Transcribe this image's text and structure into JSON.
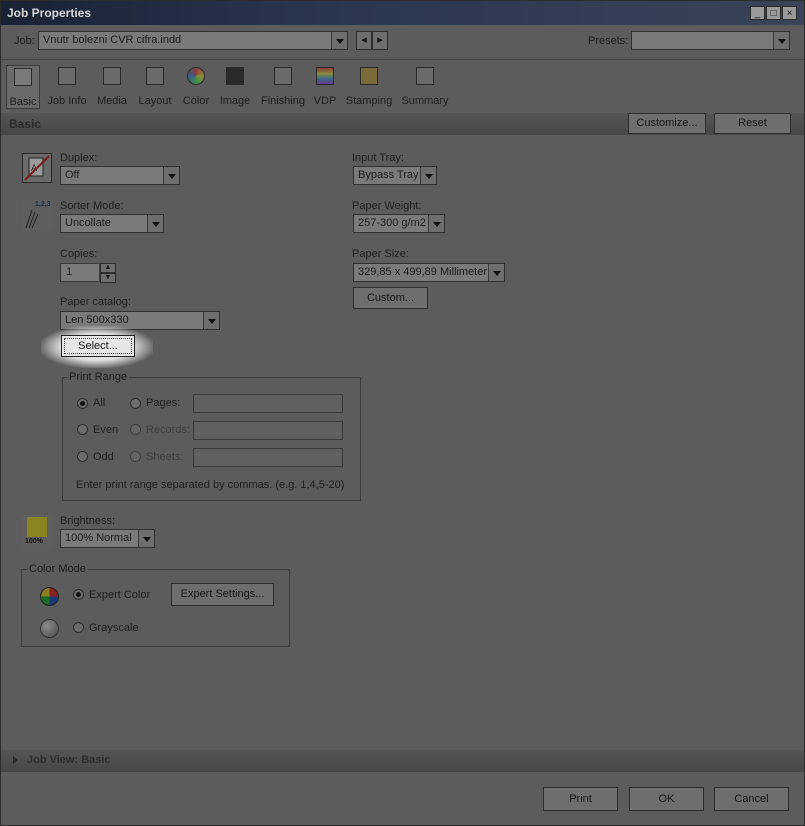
{
  "window": {
    "title": "Job Properties",
    "controls": [
      "_",
      "□",
      "×"
    ]
  },
  "jobbar": {
    "job_label": "Job:",
    "job_value": "Vnutr bolezni CVR cifra.indd",
    "presets_label": "Presets:",
    "presets_value": ""
  },
  "toolbar": {
    "items": [
      {
        "label": "Basic",
        "icon": "basic-icon"
      },
      {
        "label": "Job Info",
        "icon": "job-info-icon"
      },
      {
        "label": "Media",
        "icon": "media-icon"
      },
      {
        "label": "Layout",
        "icon": "layout-icon"
      },
      {
        "label": "Color",
        "icon": "color-icon"
      },
      {
        "label": "Image",
        "icon": "image-icon"
      },
      {
        "label": "Finishing",
        "icon": "finishing-icon"
      },
      {
        "label": "VDP",
        "icon": "vdp-icon"
      },
      {
        "label": "Stamping",
        "icon": "stamping-icon"
      },
      {
        "label": "Summary",
        "icon": "summary-icon"
      }
    ]
  },
  "section": {
    "title": "Basic",
    "customize": "Customize...",
    "reset": "Reset"
  },
  "duplex": {
    "label": "Duplex:",
    "value": "Off"
  },
  "sorter": {
    "label": "Sorter Mode:",
    "value": "Uncollate",
    "icon_text": "1,2,3"
  },
  "copies": {
    "label": "Copies:",
    "value": "1"
  },
  "paper_catalog": {
    "label": "Paper catalog:",
    "value": "Len 500x330",
    "select": "Select..."
  },
  "input_tray": {
    "label": "Input Tray:",
    "value": "Bypass Tray"
  },
  "paper_weight": {
    "label": "Paper Weight:",
    "value": "257-300 g/m2"
  },
  "paper_size": {
    "label": "Paper Size:",
    "value": "329,85 x 499,89 Millimeter",
    "custom": "Custom..."
  },
  "print_range": {
    "title": "Print Range",
    "all": "All",
    "pages": "Pages:",
    "even": "Even",
    "records": "Records:",
    "odd": "Odd",
    "sheets": "Sheets:",
    "hint": "Enter print range separated by commas. (e.g. 1,4,5-20)"
  },
  "brightness": {
    "label": "Brightness:",
    "value": "100% Normal",
    "icon_text": "100%"
  },
  "color_mode": {
    "title": "Color Mode",
    "expert": "Expert Color",
    "expert_settings": "Expert Settings...",
    "grayscale": "Grayscale"
  },
  "job_view": {
    "title": "Job View: Basic"
  },
  "footer": {
    "print": "Print",
    "ok": "OK",
    "cancel": "Cancel"
  }
}
